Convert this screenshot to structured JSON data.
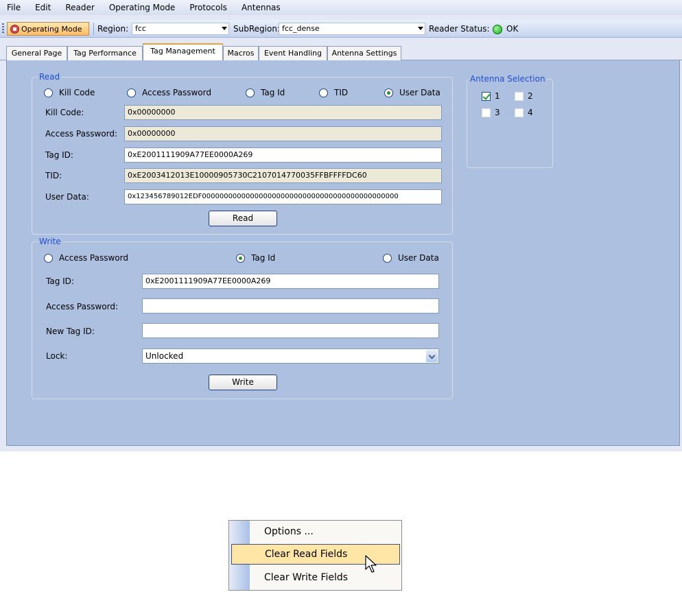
{
  "menubar": {
    "items": [
      "File",
      "Edit",
      "Reader",
      "Operating Mode",
      "Protocols",
      "Antennas"
    ]
  },
  "toolbar": {
    "operating_mode_label": "Operating Mode",
    "region_label": "Region:",
    "region_value": "fcc",
    "subregion_label": "SubRegion:",
    "subregion_value": "fcc_dense",
    "reader_status_label": "Reader Status:",
    "reader_status_value": "OK"
  },
  "tabs": [
    "General Page",
    "Tag Performance",
    "Tag Management",
    "Macros",
    "Event Handling",
    "Antenna Settings"
  ],
  "active_tab": "Tag Management",
  "read": {
    "title": "Read",
    "options": [
      "Kill Code",
      "Access Password",
      "Tag Id",
      "TID",
      "User Data"
    ],
    "selected": "User Data",
    "fields": {
      "kill_code_label": "Kill Code:",
      "kill_code_value": "0x00000000",
      "access_password_label": "Access Password:",
      "access_password_value": "0x00000000",
      "tag_id_label": "Tag ID:",
      "tag_id_value": "0xE2001111909A77EE0000A269",
      "tid_label": "TID:",
      "tid_value": "0xE2003412013E10000905730C2107014770035FFBFFFFDC60",
      "user_data_label": "User Data:",
      "user_data_value": "0x123456789012EDF000000000000000000000000000000000000000000000"
    },
    "button": "Read"
  },
  "write": {
    "title": "Write",
    "options": [
      "Access Password",
      "Tag Id",
      "User Data"
    ],
    "selected": "Tag Id",
    "fields": {
      "tag_id_label": "Tag ID:",
      "tag_id_value": "0xE2001111909A77EE0000A269",
      "access_password_label": "Access Password:",
      "access_password_value": "",
      "new_tag_id_label": "New Tag ID:",
      "new_tag_id_value": "",
      "lock_label": "Lock:",
      "lock_value": "Unlocked"
    },
    "button": "Write"
  },
  "antenna_selection": {
    "title": "Antenna Selection",
    "antennas": [
      {
        "label": "1",
        "checked": true
      },
      {
        "label": "2",
        "checked": false
      },
      {
        "label": "3",
        "checked": false
      },
      {
        "label": "4",
        "checked": false
      }
    ]
  },
  "context_menu": {
    "items": [
      "Options ...",
      "Clear Read Fields",
      "Clear Write Fields"
    ],
    "highlighted": "Clear Read Fields"
  },
  "colors": {
    "panel_bg": "#adc0e0",
    "group_title": "#1f4fd0",
    "status_ok": "#19b119",
    "operating_mode_button": "#ffbc63",
    "menu_highlight": "#ffe6a6"
  }
}
